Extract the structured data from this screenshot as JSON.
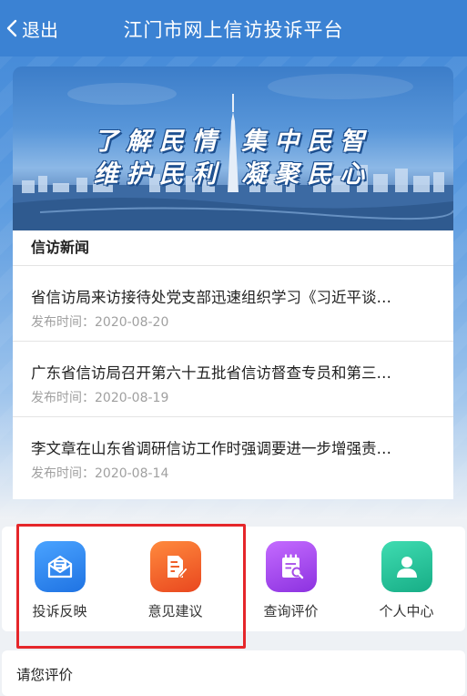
{
  "header": {
    "back_label": "退出",
    "title": "江门市网上信访投诉平台"
  },
  "banner": {
    "line1": "了解民情 集中民智",
    "line2": "维护民利 凝聚民心"
  },
  "news": {
    "heading": "信访新闻",
    "items": [
      {
        "title": "省信访局来访接待处党支部迅速组织学习《习近平谈…",
        "date": "发布时间：2020-08-20"
      },
      {
        "title": "广东省信访局召开第六十五批省信访督查专员和第三…",
        "date": "发布时间：2020-08-19"
      },
      {
        "title": "李文章在山东省调研信访工作时强调要进一步增强责…",
        "date": "发布时间：2020-08-14"
      }
    ]
  },
  "menu": {
    "items": [
      {
        "label": "投诉反映",
        "icon": "envelope-icon",
        "color": "#2f86ef"
      },
      {
        "label": "意见建议",
        "icon": "document-edit-icon",
        "color": "#f0602a"
      },
      {
        "label": "查询评价",
        "icon": "notepad-search-icon",
        "color": "#a64be8"
      },
      {
        "label": "个人中心",
        "icon": "user-icon",
        "color": "#27c39b"
      }
    ]
  },
  "rating": {
    "label": "请您评价"
  },
  "colors": {
    "header": "#3b82d3",
    "highlight": "#e5262a"
  }
}
